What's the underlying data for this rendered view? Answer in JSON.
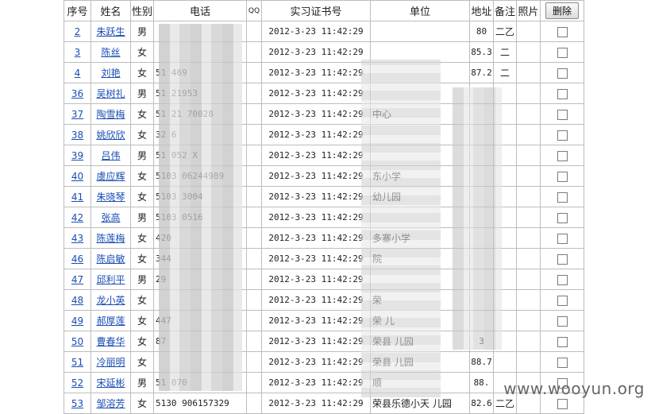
{
  "columns": {
    "no": "序号",
    "name": "姓名",
    "gender": "性别",
    "phone": "电话",
    "qq": "QQ",
    "cert": "实习证书号",
    "unit": "单位",
    "addr": "地址",
    "note": "备注",
    "photo": "照片"
  },
  "delete_label": "删除",
  "rows": [
    {
      "no": "2",
      "name": "朱跃生",
      "gender": "男",
      "phone": "",
      "time": "2012-3-23 11:42:29",
      "unit": "",
      "addr": "80",
      "note": "二乙"
    },
    {
      "no": "3",
      "name": "陈丝",
      "gender": "女",
      "phone": "",
      "time": "2012-3-23 11:42:29",
      "unit": "",
      "addr": "85.3",
      "note": "二"
    },
    {
      "no": "4",
      "name": "刘艳",
      "gender": "女",
      "phone": "51 469",
      "time": "2012-3-23 11:42:29",
      "unit": "",
      "addr": "87.2",
      "note": "二"
    },
    {
      "no": "36",
      "name": "吴树礼",
      "gender": "男",
      "phone": "51 21953",
      "time": "2012-3-23 11:42:29",
      "unit": "",
      "addr": "",
      "note": ""
    },
    {
      "no": "37",
      "name": "陶雪梅",
      "gender": "女",
      "phone": "51 21 70028",
      "time": "2012-3-23 11:42:29",
      "unit": "中心",
      "addr": "",
      "note": ""
    },
    {
      "no": "38",
      "name": "姚欣欣",
      "gender": "女",
      "phone": "32 6",
      "time": "2012-3-23 11:42:29",
      "unit": "",
      "addr": "",
      "note": ""
    },
    {
      "no": "39",
      "name": "吕伟",
      "gender": "男",
      "phone": "51 052 X",
      "time": "2012-3-23 11:42:29",
      "unit": "",
      "addr": "",
      "note": ""
    },
    {
      "no": "40",
      "name": "虞应辉",
      "gender": "女",
      "phone": "5103 06244989",
      "time": "2012-3-23 11:42:29",
      "unit": "东小学",
      "addr": "",
      "note": ""
    },
    {
      "no": "41",
      "name": "朱晓琴",
      "gender": "女",
      "phone": "5103 3004",
      "time": "2012-3-23 11:42:29",
      "unit": "幼儿园",
      "addr": "",
      "note": ""
    },
    {
      "no": "42",
      "name": "张高",
      "gender": "男",
      "phone": "5103 0516",
      "time": "2012-3-23 11:42:29",
      "unit": "",
      "addr": "",
      "note": ""
    },
    {
      "no": "43",
      "name": "陈莲梅",
      "gender": "女",
      "phone": "420",
      "time": "2012-3-23 11:42:29",
      "unit": "多寨小学",
      "addr": "",
      "note": ""
    },
    {
      "no": "46",
      "name": "陈启敏",
      "gender": "女",
      "phone": "344",
      "time": "2012-3-23 11:42:29",
      "unit": "院",
      "addr": "",
      "note": ""
    },
    {
      "no": "47",
      "name": "邱利平",
      "gender": "男",
      "phone": "29",
      "time": "2012-3-23 11:42:29",
      "unit": "",
      "addr": "",
      "note": ""
    },
    {
      "no": "48",
      "name": "龙小英",
      "gender": "女",
      "phone": "",
      "time": "2012-3-23 11:42:29",
      "unit": "荣",
      "addr": "",
      "note": ""
    },
    {
      "no": "49",
      "name": "郝厚莲",
      "gender": "女",
      "phone": "447",
      "time": "2012-3-23 11:42:29",
      "unit": "荣 儿",
      "addr": "",
      "note": ""
    },
    {
      "no": "50",
      "name": "曹春华",
      "gender": "女",
      "phone": "87",
      "time": "2012-3-23 11:42:29",
      "unit": "荣县 儿园",
      "addr": "3",
      "note": ""
    },
    {
      "no": "51",
      "name": "冷丽明",
      "gender": "女",
      "phone": "",
      "time": "2012-3-23 11:42:29",
      "unit": "荣县 儿园",
      "addr": "88.7",
      "note": ""
    },
    {
      "no": "52",
      "name": "宋延彬",
      "gender": "男",
      "phone": "51 070",
      "time": "2012-3-23 11:42:29",
      "unit": "顺",
      "addr": "88.",
      "note": ""
    },
    {
      "no": "53",
      "name": "邹溶芳",
      "gender": "女",
      "phone": "5130 906157329",
      "time": "2012-3-23 11:42:29",
      "unit": "荣县乐德小天 儿园",
      "addr": "82.6",
      "note": "二乙"
    }
  ],
  "watermark": "www.wooyun.org"
}
